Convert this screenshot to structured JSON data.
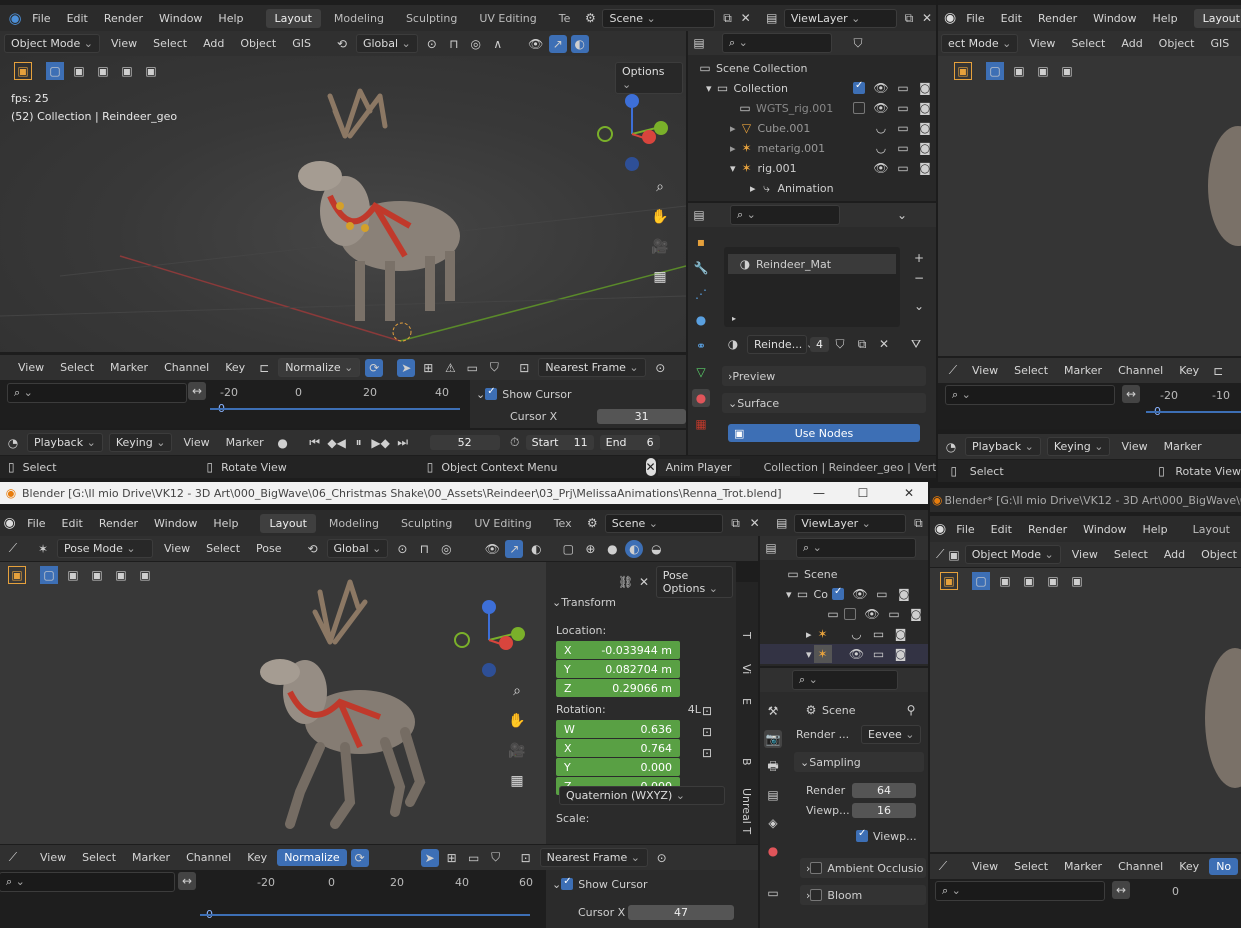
{
  "menus": {
    "file": "File",
    "edit": "Edit",
    "render": "Render",
    "window": "Window",
    "help": "Help"
  },
  "tabs": {
    "layout": "Layout",
    "modeling": "Modeling",
    "sculpting": "Sculpting",
    "uv": "UV Editing",
    "te": "Te",
    "tex": "Tex"
  },
  "scene": "Scene",
  "viewlayer": "ViewLayer",
  "viewport_menu": {
    "view": "View",
    "select": "Select",
    "add": "Add",
    "object": "Object",
    "gis": "GIS",
    "pose": "Pose"
  },
  "modes": {
    "object": "Object Mode",
    "object_cut": "ect Mode",
    "pose": "Pose Mode"
  },
  "transform_orient": "Global",
  "options": "Options",
  "pose_options": "Pose Options",
  "overlay": {
    "fps": "fps: 25",
    "collection_info": "(52) Collection | Reindeer_geo"
  },
  "outliner_tl": [
    {
      "label": "Scene Collection"
    },
    {
      "label": "Collection"
    },
    {
      "label": "WGTS_rig.001"
    },
    {
      "label": "Cube.001"
    },
    {
      "label": "metarig.001"
    },
    {
      "label": "rig.001"
    },
    {
      "label": "Animation"
    }
  ],
  "outliner_bl": {
    "scene": "Scene",
    "co": "Co"
  },
  "material": {
    "slot": "Reindeer_Mat",
    "short": "Reinde...",
    "users": "4",
    "preview": "Preview",
    "surface": "Surface",
    "use_nodes": "Use Nodes"
  },
  "graph_menu": {
    "view": "View",
    "select": "Select",
    "marker": "Marker",
    "channel": "Channel",
    "key": "Key",
    "normalize": "Normalize",
    "nearest": "Nearest Frame",
    "normalize_cut": "No"
  },
  "ruler_tl": [
    "-20",
    "0",
    "20",
    "40"
  ],
  "ruler_bl": [
    "-20",
    "0",
    "20",
    "40",
    "60"
  ],
  "ruler_tr": [
    "-20",
    "-10"
  ],
  "ruler_br": [
    "0"
  ],
  "cursor_zero": "0",
  "show_cursor": "Show Cursor",
  "cursor_x_label": "Cursor X",
  "cursor_x_tl": "31",
  "cursor_x_bl": "47",
  "timeline": {
    "playback": "Playback",
    "keying": "Keying",
    "view": "View",
    "marker": "Marker",
    "frame": "52",
    "start_label": "Start",
    "start": "11",
    "end_label": "End",
    "end_cut": "6"
  },
  "status": {
    "select": "Select",
    "rotate": "Rotate View",
    "context": "Object Context Menu",
    "anim": "Anim Player",
    "info": "Collection | Reindeer_geo | Verts:"
  },
  "titles": {
    "bottom_left": "Blender [G:\\Il mio Drive\\VK12 - 3D Art\\000_BigWave\\06_Christmas Shake\\00_Assets\\Reindeer\\03_Prj\\MelissaAnimations\\Renna_Trot.blend]",
    "bottom_right": "Blender* [G:\\Il mio Drive\\VK12 - 3D Art\\000_BigWave\\0"
  },
  "transform": {
    "title": "Transform",
    "location": "Location:",
    "loc": [
      {
        "axis": "X",
        "value": "-0.033944 m"
      },
      {
        "axis": "Y",
        "value": "0.082704 m"
      },
      {
        "axis": "Z",
        "value": "0.29066 m"
      }
    ],
    "rotation": "Rotation:",
    "rot_mode_short": "4L",
    "rot": [
      {
        "axis": "W",
        "value": "0.636"
      },
      {
        "axis": "X",
        "value": "0.764"
      },
      {
        "axis": "Y",
        "value": "0.000"
      },
      {
        "axis": "Z",
        "value": "0.000"
      }
    ],
    "rot_mode": "Quaternion (WXYZ)",
    "scale": "Scale:"
  },
  "side_tabs": [
    "T",
    "Vi",
    "E",
    "B",
    "Unreal T"
  ],
  "render_props": {
    "scene": "Scene",
    "engine_label": "Render ...",
    "engine": "Eevee",
    "sampling": "Sampling",
    "render_label": "Render",
    "render_val": "64",
    "viewport_label": "Viewp...",
    "viewport_val": "16",
    "viewport_denoise": "Viewp...",
    "ao": "Ambient Occlusio",
    "bloom": "Bloom"
  },
  "colors": {
    "accent": "#3d6fb5",
    "green_field": "#59a044",
    "header": "#303030",
    "panel": "#2b2b2b"
  }
}
